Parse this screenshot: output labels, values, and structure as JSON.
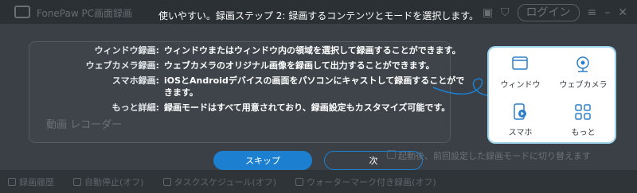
{
  "app": {
    "title": "FonePaw PC画面録画",
    "login_label": "ログイン",
    "background_card_label": "動画 レコーダー",
    "mode_switch_hint": "起動後、前回設定した録画モードに切り替えます",
    "bottom_bar": [
      "録画履歴",
      "自動停止(オフ)",
      "タスクスケジュール(オフ)",
      "ウォーターマーク付き録画(オフ)"
    ]
  },
  "tutorial": {
    "step_title": "使いやすい。録画ステップ 2: 録画するコンテンツとモードを選択します。",
    "descriptions": [
      {
        "term": "ウィンドウ録画:",
        "text": "ウィンドウまたはウィンドウ内の領域を選択して録画することができます。"
      },
      {
        "term": "ウェブカメラ録画:",
        "text": "ウェブカメラのオリジナル画像を録画して出力することができます。"
      },
      {
        "term": "スマホ録画:",
        "text": "iOSとAndroidデバイスの画面をパソコンにキャストして録画することができます。"
      },
      {
        "term": "もっと詳細:",
        "text": "録画モードはすべて用意されており、録画設定もカスタマイズ可能です。"
      }
    ],
    "modes": [
      {
        "label": "ウィンドウ",
        "icon": "window-icon"
      },
      {
        "label": "ウェブカメラ",
        "icon": "webcam-icon"
      },
      {
        "label": "スマホ",
        "icon": "phone-icon"
      },
      {
        "label": "もっと",
        "icon": "grid-icon"
      }
    ],
    "skip_label": "スキップ",
    "next_label": "次",
    "accent_color": "#1c7fd0",
    "highlight_color": "#9fd4ec"
  }
}
